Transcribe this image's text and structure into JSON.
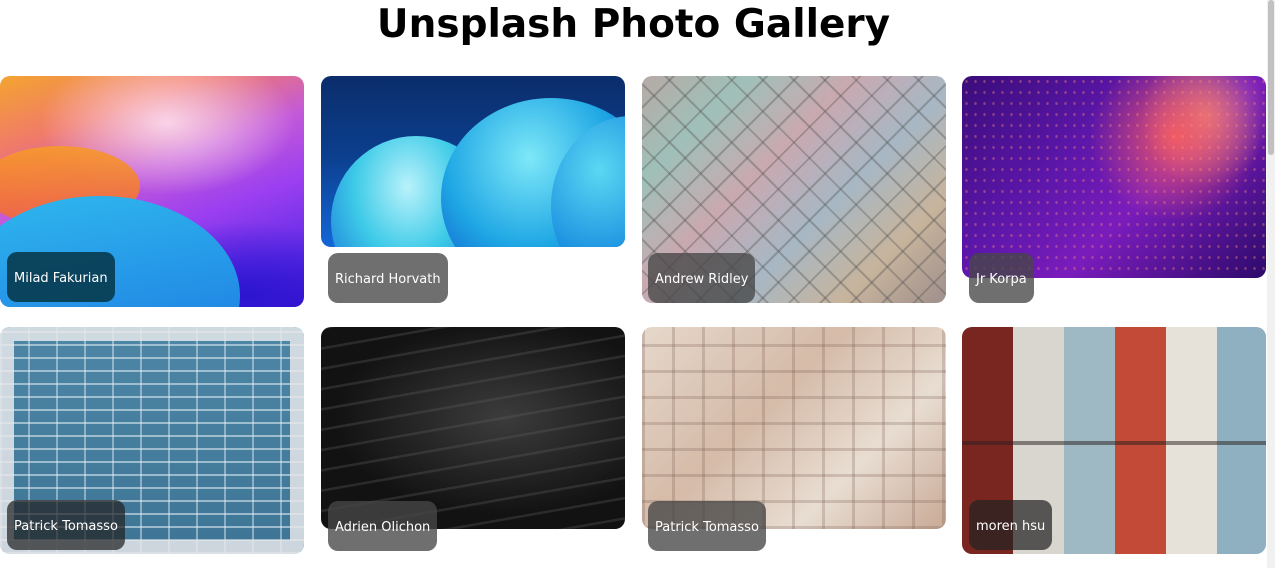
{
  "page": {
    "title": "Unsplash Photo Gallery"
  },
  "gallery": {
    "photos": [
      {
        "author": "Milad Fakurian"
      },
      {
        "author": "Richard Horvath"
      },
      {
        "author": "Andrew Ridley"
      },
      {
        "author": "Jr Korpa"
      },
      {
        "author": "Patrick Tomasso"
      },
      {
        "author": "Adrien Olichon"
      },
      {
        "author": "Patrick Tomasso"
      },
      {
        "author": "moren hsu"
      }
    ]
  }
}
